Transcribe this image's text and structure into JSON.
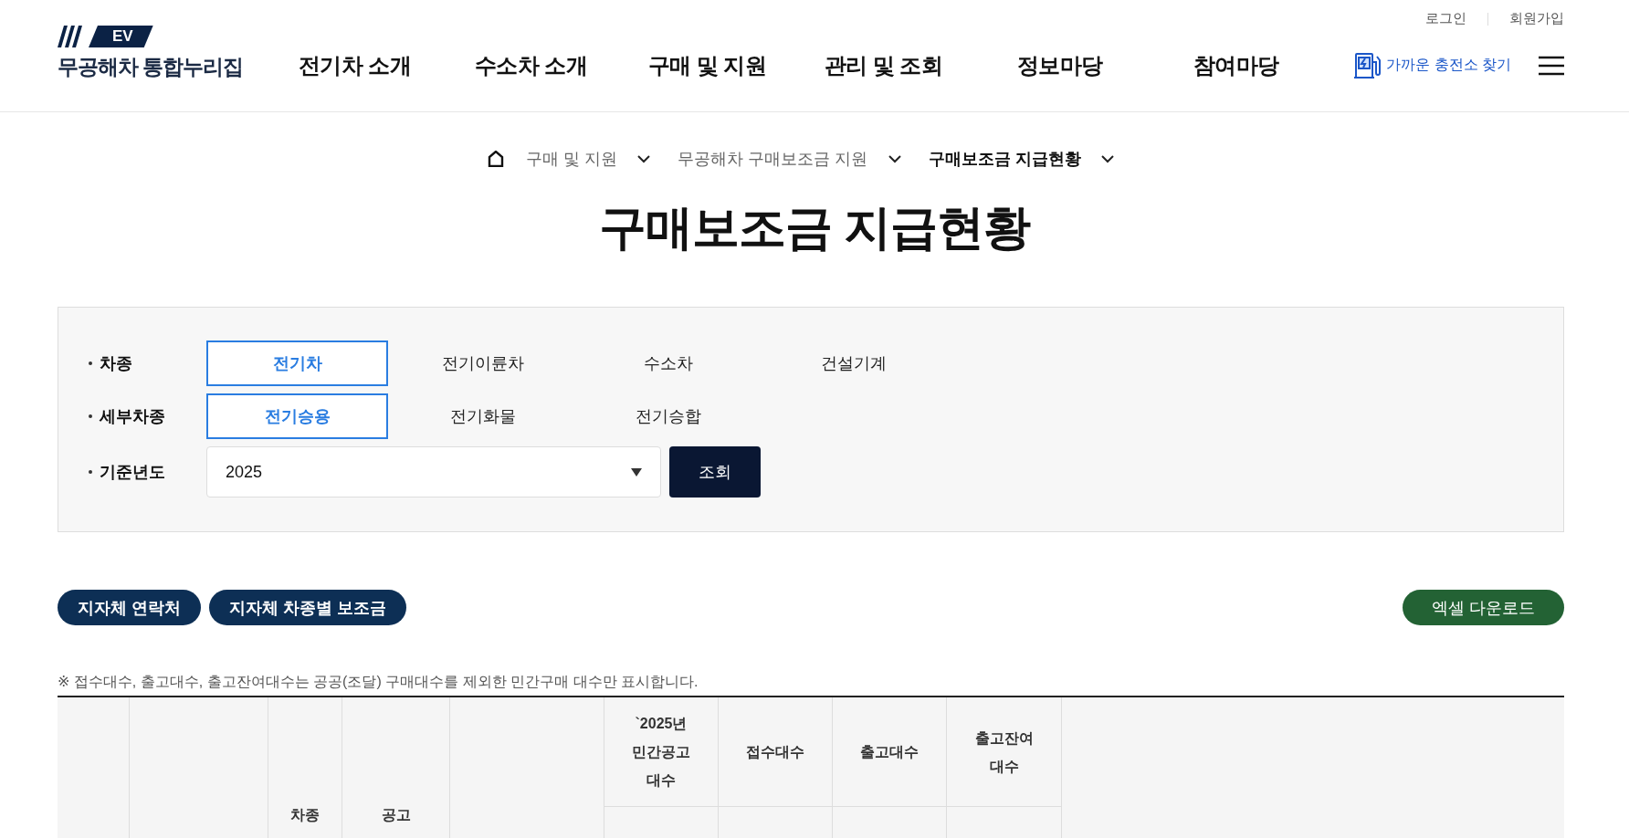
{
  "header": {
    "logo_badge": "EV",
    "logo_text": "무공해차 통합누리집",
    "top_links": [
      "로그인",
      "회원가입"
    ],
    "nav": [
      "전기차 소개",
      "수소차 소개",
      "구매 및 지원",
      "관리 및 조회",
      "정보마당",
      "참여마당"
    ],
    "charger_link": "가까운 충전소 찾기"
  },
  "breadcrumb": [
    {
      "label": "구매 및 지원",
      "current": false
    },
    {
      "label": "무공해차 구매보조금 지원",
      "current": false
    },
    {
      "label": "구매보조금 지급현황",
      "current": true
    }
  ],
  "page_title": "구매보조금 지급현황",
  "filters": [
    {
      "label": "차종",
      "kind": "options",
      "options": [
        {
          "label": "전기차",
          "selected": true
        },
        {
          "label": "전기이륜차",
          "selected": false
        },
        {
          "label": "수소차",
          "selected": false
        },
        {
          "label": "건설기계",
          "selected": false
        }
      ]
    },
    {
      "label": "세부차종",
      "kind": "options",
      "options": [
        {
          "label": "전기승용",
          "selected": true
        },
        {
          "label": "전기화물",
          "selected": false
        },
        {
          "label": "전기승합",
          "selected": false
        }
      ]
    },
    {
      "label": "기준년도",
      "kind": "select",
      "value": "2025",
      "button": "조회"
    }
  ],
  "actions": {
    "left": [
      "지자체 연락처",
      "지자체 차종별 보조금"
    ],
    "right": [
      "엑셀 다운로드"
    ]
  },
  "note": "※ 접수대수, 출고대수, 출고잔여대수는 공공(조달) 구매대수를 제외한 민간구매 대수만 표시합니다.",
  "table": {
    "columns": [
      {
        "kind": "merged"
      },
      {
        "kind": "merged"
      },
      {
        "kind": "merged",
        "label": "차종"
      },
      {
        "kind": "merged",
        "label": "공고"
      },
      {
        "kind": "merged"
      },
      {
        "kind": "split",
        "label": "`2025년\n민간공고\n대수"
      },
      {
        "kind": "split",
        "label": "접수대수"
      },
      {
        "kind": "split",
        "label": "출고대수"
      },
      {
        "kind": "split",
        "label": "출고잔여\n대수"
      },
      {
        "kind": "merged"
      }
    ]
  }
}
